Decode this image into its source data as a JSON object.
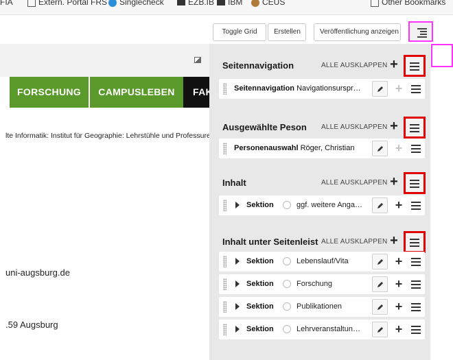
{
  "bookmarks": {
    "items": [
      {
        "label": "FIA",
        "icon": "text"
      },
      {
        "label": "Extern. Portal FRS",
        "icon": "page-icon"
      },
      {
        "label": "Singlecheck",
        "icon": "globe-icon"
      },
      {
        "label": "EZB.IB",
        "icon": "logo-icon"
      },
      {
        "label": "IBM",
        "icon": "logo-icon"
      },
      {
        "label": "CEUS",
        "icon": "badge-icon"
      },
      {
        "label": "Other Bookmarks",
        "icon": "folder-icon"
      }
    ]
  },
  "toolbar": {
    "toggle_grid": "Toggle Grid",
    "create": "Erstellen",
    "show_publication": "Veröffentlichung anzeigen"
  },
  "page": {
    "nav": [
      "FORSCHUNG",
      "CAMPUSLEBEN",
      "FAK"
    ],
    "breadcrumb": "lte Informatik: Institut für Geographie: Lehrstühle und Professuren",
    "email": "uni-augsburg.de",
    "city": ".59 Augsburg",
    "colors": {
      "nav_green": "#5a9a2a",
      "nav_black": "#111111"
    }
  },
  "panel": {
    "expand_label": "ALLE AUSKLAPPEN",
    "sections": [
      {
        "title": "Seitennavigation",
        "rows": [
          {
            "bold": "Seitennavigation",
            "text": "Navigationsurspr…",
            "plus_disabled": true
          }
        ]
      },
      {
        "title": "Ausgewählte Peson",
        "rows": [
          {
            "bold": "Personenauswahl",
            "text": "Röger, Christian",
            "plus_disabled": true
          }
        ]
      },
      {
        "title": "Inhalt",
        "rows": [
          {
            "sektion": "Sektion",
            "text": "ggf. weitere Anga…",
            "plus_disabled": false
          }
        ]
      },
      {
        "title": "Inhalt unter Seitenleist",
        "rows": [
          {
            "sektion": "Sektion",
            "text": "Lebenslauf/Vita",
            "plus_disabled": false
          },
          {
            "sektion": "Sektion",
            "text": "Forschung",
            "plus_disabled": false
          },
          {
            "sektion": "Sektion",
            "text": "Publikationen",
            "plus_disabled": false
          },
          {
            "sektion": "Sektion",
            "text": "Lehrveranstaltun…",
            "plus_disabled": false
          }
        ]
      }
    ]
  }
}
